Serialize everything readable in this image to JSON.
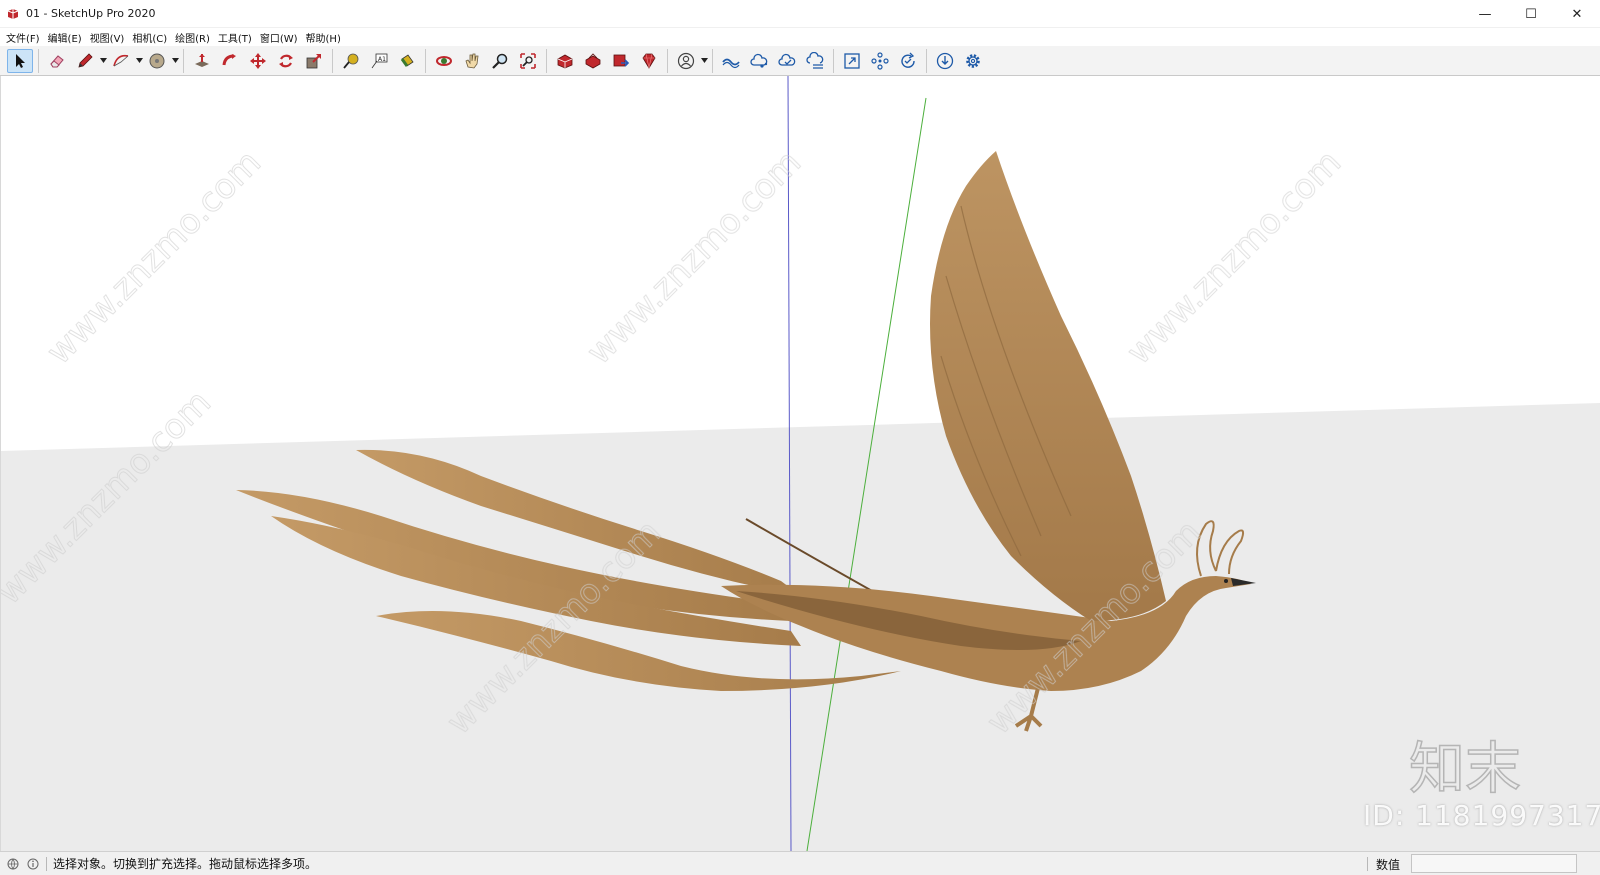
{
  "window": {
    "title": "01 - SketchUp Pro 2020",
    "minimize_glyph": "—",
    "maximize_glyph": "☐",
    "close_glyph": "✕"
  },
  "menu": {
    "items": [
      "文件(F)",
      "编辑(E)",
      "视图(V)",
      "相机(C)",
      "绘图(R)",
      "工具(T)",
      "窗口(W)",
      "帮助(H)"
    ]
  },
  "toolbar": {
    "tools": [
      {
        "name": "select-tool",
        "icon": "arrow-cursor-icon",
        "active": true
      },
      {
        "name": "eraser-tool",
        "icon": "eraser-icon"
      },
      {
        "name": "line-tool",
        "icon": "pencil-icon",
        "dropdown": true
      },
      {
        "name": "arc-tool",
        "icon": "arc-icon",
        "dropdown": true
      },
      {
        "name": "shape-tool",
        "icon": "circle-shape-icon",
        "dropdown": true
      },
      {
        "name": "push-pull-tool",
        "icon": "push-pull-icon"
      },
      {
        "name": "follow-me-tool",
        "icon": "follow-me-icon"
      },
      {
        "name": "move-tool",
        "icon": "move-arrows-icon"
      },
      {
        "name": "rotate-tool",
        "icon": "rotate-icon"
      },
      {
        "name": "scale-tool",
        "icon": "scale-icon"
      },
      {
        "name": "tape-measure-tool",
        "icon": "tape-measure-icon"
      },
      {
        "name": "text-tool",
        "icon": "text-label-icon"
      },
      {
        "name": "paint-bucket-tool",
        "icon": "paint-bucket-icon"
      },
      {
        "name": "orbit-tool",
        "icon": "orbit-icon"
      },
      {
        "name": "pan-tool",
        "icon": "hand-pan-icon"
      },
      {
        "name": "zoom-tool",
        "icon": "magnifier-icon"
      },
      {
        "name": "zoom-extents-tool",
        "icon": "zoom-extents-icon"
      },
      {
        "name": "3d-warehouse-tool",
        "icon": "warehouse-icon"
      },
      {
        "name": "extension-warehouse-tool",
        "icon": "extension-icon"
      },
      {
        "name": "send-to-layout-tool",
        "icon": "layout-icon"
      },
      {
        "name": "extension-manager-tool",
        "icon": "ruby-gem-icon"
      },
      {
        "name": "account-tool",
        "icon": "user-account-icon",
        "dropdown": true
      },
      {
        "name": "trimble-connect-tool",
        "icon": "cloud-link-icon"
      },
      {
        "name": "cloud-share-tool",
        "icon": "cloud-share-icon"
      },
      {
        "name": "cloud-sync-tool",
        "icon": "cloud-check-icon"
      },
      {
        "name": "cloud-list-tool",
        "icon": "cloud-list-icon"
      },
      {
        "name": "expand-tool",
        "icon": "expand-frame-icon"
      },
      {
        "name": "network-tool",
        "icon": "network-nodes-icon"
      },
      {
        "name": "refresh-tool",
        "icon": "refresh-check-icon"
      },
      {
        "name": "download-tool",
        "icon": "download-circle-icon"
      },
      {
        "name": "settings-tool",
        "icon": "gear-icon"
      }
    ],
    "separators_after": [
      0,
      4,
      9,
      12,
      16,
      20,
      21,
      25,
      28
    ]
  },
  "viewport": {
    "model": "phoenix",
    "model_color": "#b48a58",
    "blue_axis_color": "#5a5ac8",
    "green_axis_color": "#4caf3c",
    "ground_color": "#ebebeb",
    "sky_color": "#ffffff"
  },
  "watermark": {
    "text": "www.znzmo.com",
    "logo_text": "知末",
    "id_text": "ID: 1181997317"
  },
  "status": {
    "message": "选择对象。切换到扩充选择。拖动鼠标选择多项。",
    "measurements_label": "数值",
    "measurements_value": ""
  }
}
